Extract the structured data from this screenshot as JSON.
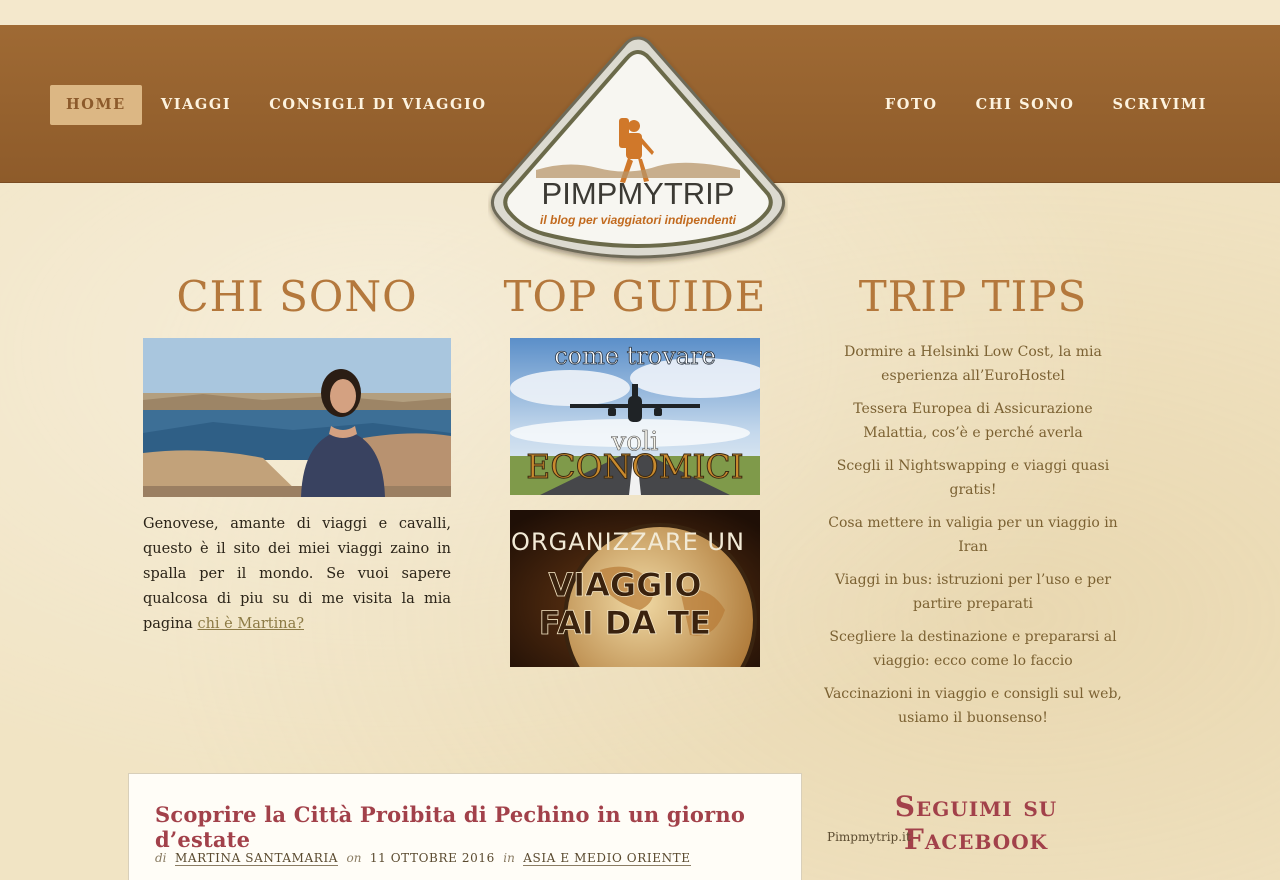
{
  "header": {
    "nav_left": [
      "HOME",
      "VIAGGI",
      "CONSIGLI DI VIAGGIO"
    ],
    "nav_right": [
      "FOTO",
      "CHI SONO",
      "SCRIVIMI"
    ]
  },
  "logo": {
    "brand": "PIMPMYTRIP",
    "tagline": "il blog per viaggiatori indipendenti"
  },
  "columns": {
    "about": {
      "title": "CHI SONO",
      "bio": "Genovese, amante di viaggi e cavalli, questo è il sito dei miei viaggi zaino in spalla per il mondo. Se vuoi sapere qualcosa di piu su di me visita la mia pagina ",
      "link": "chi è Martina?"
    },
    "guides": {
      "title": "TOP GUIDE",
      "guide1": {
        "line1": "come trovare",
        "line2": "voli",
        "line3": "ECONOMICI"
      },
      "guide2": {
        "line1": "ORGANIZZARE UN",
        "line2": "VIAGGIO",
        "line3": "FAI DA TE"
      }
    },
    "tips": {
      "title": "TRIP TIPS",
      "items": [
        "Dormire a Helsinki Low Cost, la mia esperienza all’EuroHostel",
        "Tessera Europea di Assicurazione Malattia, cos’è e perché averla",
        "Scegli il Nightswapping e viaggi quasi gratis!",
        "Cosa mettere in valigia per un viaggio in Iran",
        "Viaggi in bus: istruzioni per l’uso e per partire preparati",
        "Scegliere la destinazione e prepararsi al viaggio: ecco come lo faccio",
        "Vaccinazioni in viaggio e consigli sul web, usiamo il buonsenso!"
      ]
    }
  },
  "post": {
    "title": "Scoprire la Città Proibita di Pechino in un giorno d’estate",
    "by_label": "di",
    "author": "MARTINA SANTAMARIA",
    "on_label": "on",
    "date": "11 OTTOBRE 2016",
    "in_label": "in",
    "category": "ASIA E MEDIO ORIENTE"
  },
  "sidebar": {
    "fb_title": "Seguimi su Facebook",
    "fb_page": "Pimpmytrip.it"
  },
  "colors": {
    "nav_bg": "#9a6530",
    "accent_gold": "#b4783c",
    "post_title": "#a2414a",
    "tips_text": "#7b6132"
  }
}
